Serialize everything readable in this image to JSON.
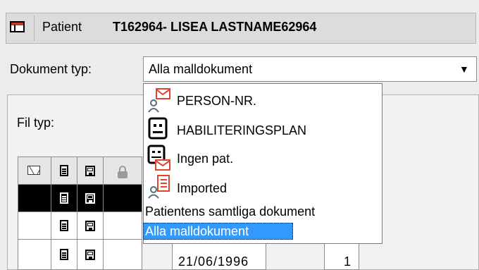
{
  "header": {
    "patient_label": "Patient",
    "patient_value": "T162964- LISEA LASTNAME62964"
  },
  "document_type": {
    "label": "Dokument typ:",
    "selected": "Alla malldokument"
  },
  "filter": {
    "label": "Fil typ:"
  },
  "dropdown": {
    "options": [
      {
        "label": "PERSON-NR.",
        "icon": "person-mail-icon"
      },
      {
        "label": "HABILITERINGSPLAN",
        "icon": "form-icon"
      },
      {
        "label": "Ingen pat.",
        "icon": "form-mail-icon"
      },
      {
        "label": "Imported",
        "icon": "person-list-icon"
      },
      {
        "label": "Patientens samtliga dokument",
        "icon": ""
      },
      {
        "label": "Alla malldokument",
        "icon": ""
      }
    ],
    "selected_index": 5
  },
  "table": {
    "header_icons": [
      "mail-icon",
      "document-icon",
      "save-icon",
      "lock-icon"
    ],
    "partial_row_text": "21/06/1996",
    "partial_row_count": "1"
  },
  "colors": {
    "selection": "#3399ff",
    "accent": "#e0452f"
  }
}
